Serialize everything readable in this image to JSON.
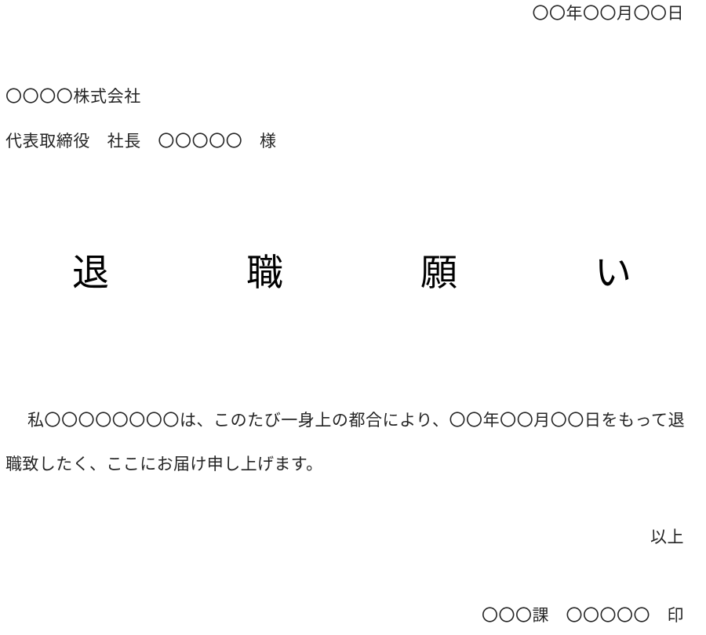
{
  "document": {
    "type": "resignation-letter",
    "language": "ja",
    "page_background": "#ffffff",
    "text_color": "#242424",
    "title_color": "#000000"
  },
  "date_line": {
    "text": "〇〇年〇〇月〇〇日"
  },
  "addressee": {
    "company": "〇〇〇〇株式会社",
    "person": "代表取締役　社長　〇〇〇〇〇　様"
  },
  "title": {
    "text": "退職願い"
  },
  "body": {
    "paragraph": "私〇〇〇〇〇〇〇〇は、このたび一身上の都合により、〇〇年〇〇月〇〇日をもって退職致したく、ここにお届け申し上げます。"
  },
  "closing": {
    "note": "以上"
  },
  "signature": {
    "line": "〇〇〇課　〇〇〇〇〇　印"
  }
}
